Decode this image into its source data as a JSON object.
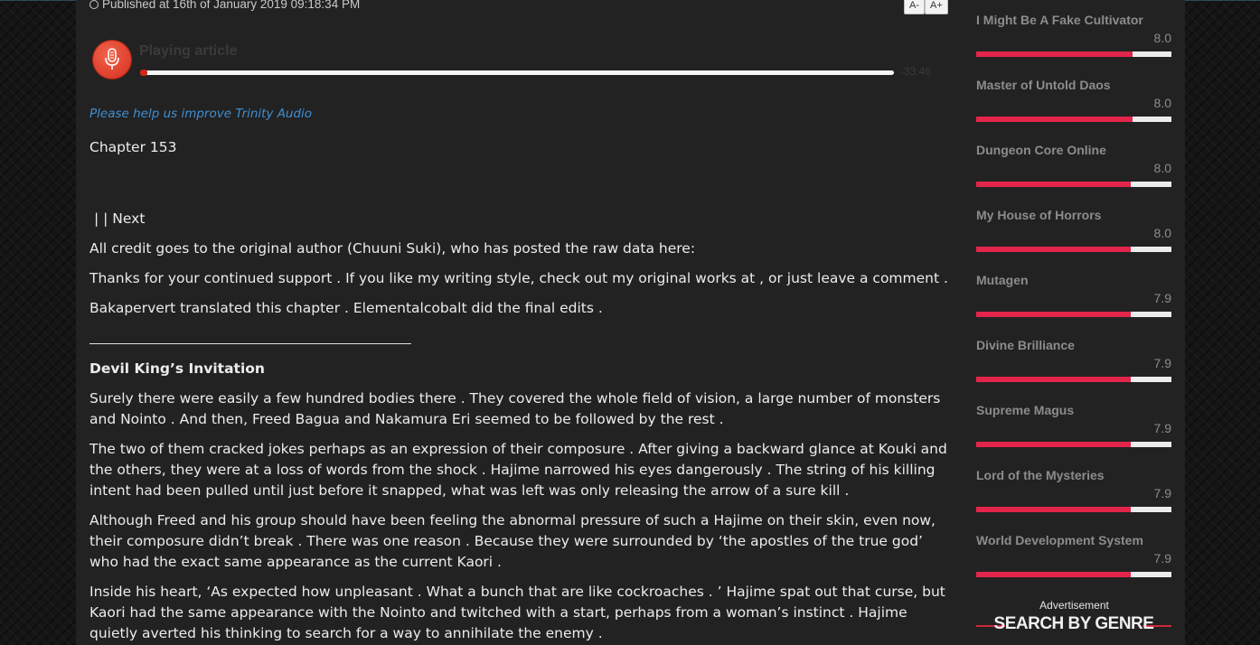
{
  "article": {
    "published": "Published at 16th of January 2019 09:18:34 PM",
    "font_smaller": "A-",
    "font_larger": "A+",
    "player": {
      "title": "Playing article",
      "time": "-33:46",
      "progress": 0.01
    },
    "help_link": "Please help us improve Trinity Audio",
    "chapter": "Chapter 153",
    "nav": "|  | Next",
    "credit": "All credit goes to the original author (Chuuni Suki), who has posted the raw data here:",
    "support": "Thanks for your continued support . If you like my writing style, check out my original works at , or just leave a comment .",
    "translator": "Bakapervert translated this chapter . Elementalcobalt did the final edits .",
    "heading": "Devil King’s Invitation",
    "paragraphs": [
      "Surely there were easily a few hundred bodies there . They covered the whole field of vision, a large number of monsters and Nointo . And then, Freed Bagua and Nakamura Eri seemed to be followed by the rest .",
      "The two of them cracked jokes perhaps as an expression of their composure . After giving a backward glance at Kouki and the others, they were at a loss of words from the shock . Hajime narrowed his eyes dangerously . The string of his killing intent had been pulled until just before it snapped, what was left was only releasing the arrow of a sure kill .",
      "Although Freed and his group should have been feeling the abnormal pressure of such a Hajime on their skin, even now, their composure didn’t break . There was one reason . Because they were surrounded by ‘the apostles of the true god’ who had the exact same appearance as the current Kaori .",
      "Inside his heart, ‘As expected how unpleasant . What a bunch that are like cockroaches . ’ Hajime spat out that curse, but Kaori had the same appearance with the Nointo and twitched with a start, perhaps from a woman’s instinct . Hajime quietly averted his thinking to search for a way to annihilate the enemy ."
    ]
  },
  "sidebar": {
    "items": [
      {
        "title": "I Might Be A Fake Cultivator",
        "score": "8.0",
        "rating": 0.8
      },
      {
        "title": "Master of Untold Daos",
        "score": "8.0",
        "rating": 0.8
      },
      {
        "title": "Dungeon Core Online",
        "score": "8.0",
        "rating": 0.79
      },
      {
        "title": "My House of Horrors",
        "score": "8.0",
        "rating": 0.79
      },
      {
        "title": "Mutagen",
        "score": "7.9",
        "rating": 0.79
      },
      {
        "title": "Divine Brilliance",
        "score": "7.9",
        "rating": 0.79
      },
      {
        "title": "Supreme Magus",
        "score": "7.9",
        "rating": 0.79
      },
      {
        "title": "Lord of the Mysteries",
        "score": "7.9",
        "rating": 0.79
      },
      {
        "title": "World Development System",
        "score": "7.9",
        "rating": 0.79
      }
    ],
    "advertisement": "Advertisement",
    "genre_heading": "SEARCH BY GENRE"
  },
  "colors": {
    "accent": "#e3254b",
    "link": "#3f8fd2",
    "player_red": "#d02617"
  }
}
